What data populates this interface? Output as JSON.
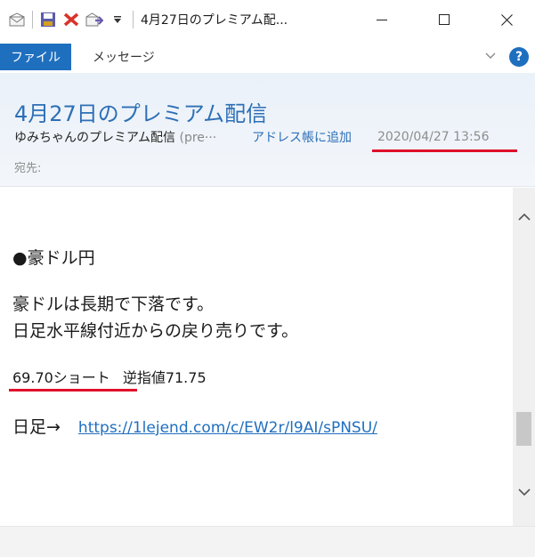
{
  "window": {
    "title": "4月27日のプレミアム配..."
  },
  "ribbon": {
    "file_tab": "ファイル",
    "message_tab": "メッセージ",
    "help": "?"
  },
  "header": {
    "subject": "4月27日のプレミアム配信",
    "sender_name": "ゆみちゃんのプレミアム配信",
    "sender_extra": " (pre···",
    "add_to_address_book": "アドレス帳に追加",
    "date": "2020/04/27 13:56",
    "to_label": "宛先:"
  },
  "body": {
    "line1": "●豪ドル円",
    "line2": "豪ドルは長期で下落です。",
    "line3": "日足水平線付近からの戻り売りです。",
    "short": "69.70ショート",
    "stop": "逆指値71.75",
    "daily_label": "日足→",
    "link": "https://1lejend.com/c/EW2r/l9AI/sPNSU/"
  },
  "colors": {
    "accent": "#1f6fbf",
    "subject": "#2d6fb6",
    "highlight_underline": "#e0102a"
  },
  "icons": [
    "mail-icon",
    "save-icon",
    "delete-icon",
    "forward-icon",
    "dropdown-icon",
    "minimize-icon",
    "maximize-icon",
    "close-icon",
    "chevron-down-icon",
    "help-icon",
    "scroll-up-icon",
    "scroll-down-icon"
  ]
}
